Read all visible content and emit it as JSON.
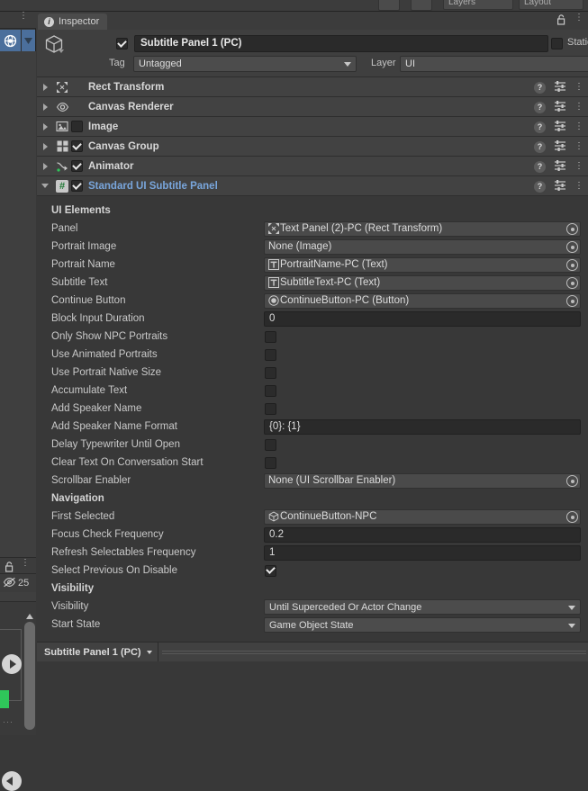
{
  "top_toolbar": {
    "layers_label": "Layers",
    "layout_label": "Layout"
  },
  "left_rail": {
    "tool_icon": "globe-handle-icon",
    "tool_caret_icon": "chevron-down-icon",
    "kebab_icon": "kebab-menu-icon",
    "lock_icon": "lock-open-icon",
    "hidden_count": "25",
    "hidden_icon": "eye-slash-icon",
    "play_icon": "play-circle-icon"
  },
  "tab": {
    "label": "Inspector",
    "info_icon": "info-icon",
    "badge_char": "i",
    "lock_icon": "lock-open-icon",
    "kebab_icon": "kebab-menu-icon"
  },
  "object_header": {
    "cube_icon": "gameobject-cube-icon",
    "enabled": true,
    "name": "Subtitle Panel 1 (PC)",
    "static_label": "Static",
    "static_checked": false,
    "tag_label": "Tag",
    "tag_value": "Untagged",
    "layer_label": "Layer",
    "layer_value": "UI"
  },
  "components": [
    {
      "name": "Rect Transform",
      "icon": "rect-transform-icon",
      "expanded": false,
      "has_checkbox": false,
      "checked": false,
      "is_script": false
    },
    {
      "name": "Canvas Renderer",
      "icon": "eye-icon",
      "expanded": false,
      "has_checkbox": false,
      "checked": false,
      "is_script": false
    },
    {
      "name": "Image",
      "icon": "image-icon",
      "expanded": false,
      "has_checkbox": true,
      "checked": false,
      "is_script": false
    },
    {
      "name": "Canvas Group",
      "icon": "canvas-group-icon",
      "expanded": false,
      "has_checkbox": true,
      "checked": true,
      "is_script": false
    },
    {
      "name": "Animator",
      "icon": "animator-icon",
      "expanded": false,
      "has_checkbox": true,
      "checked": true,
      "is_script": false
    },
    {
      "name": "Standard UI Subtitle Panel",
      "icon": "script-icon",
      "expanded": true,
      "has_checkbox": true,
      "checked": true,
      "is_script": true
    }
  ],
  "component_row_icons": {
    "help_char": "?",
    "help_icon": "help-icon",
    "preset_icon": "preset-sliders-icon",
    "kebab_icon": "kebab-menu-icon"
  },
  "properties": [
    {
      "kind": "section",
      "label": "UI Elements"
    },
    {
      "kind": "object",
      "label": "Panel",
      "value": "Text Panel (2)-PC (Rect Transform)",
      "icon": "rect-transform-icon",
      "has_icon": true
    },
    {
      "kind": "object",
      "label": "Portrait Image",
      "value": "None (Image)",
      "icon": "none-icon",
      "has_icon": false
    },
    {
      "kind": "object",
      "label": "Portrait Name",
      "value": "PortraitName-PC (Text)",
      "icon": "text-icon",
      "has_icon": true
    },
    {
      "kind": "object",
      "label": "Subtitle Text",
      "value": "SubtitleText-PC (Text)",
      "icon": "text-icon",
      "has_icon": true
    },
    {
      "kind": "object",
      "label": "Continue Button",
      "value": "ContinueButton-PC (Button)",
      "icon": "button-icon",
      "has_icon": true
    },
    {
      "kind": "number",
      "label": "Block Input Duration",
      "value": "0"
    },
    {
      "kind": "bool",
      "label": "Only Show NPC Portraits",
      "checked": false
    },
    {
      "kind": "bool",
      "label": "Use Animated Portraits",
      "checked": false
    },
    {
      "kind": "bool",
      "label": "Use Portrait Native Size",
      "checked": false
    },
    {
      "kind": "bool",
      "label": "Accumulate Text",
      "checked": false
    },
    {
      "kind": "bool",
      "label": "Add Speaker Name",
      "checked": false
    },
    {
      "kind": "number",
      "label": "Add Speaker Name Format",
      "value": "{0}: {1}"
    },
    {
      "kind": "bool",
      "label": "Delay Typewriter Until Open",
      "checked": false
    },
    {
      "kind": "bool",
      "label": "Clear Text On Conversation Start",
      "checked": false
    },
    {
      "kind": "object",
      "label": "Scrollbar Enabler",
      "value": "None (UI Scrollbar Enabler)",
      "icon": "none-icon",
      "has_icon": false
    },
    {
      "kind": "section",
      "label": "Navigation"
    },
    {
      "kind": "object",
      "label": "First Selected",
      "value": "ContinueButton-NPC",
      "icon": "gameobject-cube-icon",
      "has_icon": true
    },
    {
      "kind": "number",
      "label": "Focus Check Frequency",
      "value": "0.2"
    },
    {
      "kind": "number",
      "label": "Refresh Selectables Frequency",
      "value": "1"
    },
    {
      "kind": "bool",
      "label": "Select Previous On Disable",
      "checked": true
    },
    {
      "kind": "section",
      "label": "Visibility"
    },
    {
      "kind": "dropdown",
      "label": "Visibility",
      "value": "Until Superceded Or Actor Change"
    },
    {
      "kind": "dropdown",
      "label": "Start State",
      "value": "Game Object State"
    }
  ],
  "footer": {
    "breadcrumb": "Subtitle Panel 1 (PC)",
    "caret_icon": "chevron-down-icon"
  },
  "colors": {
    "background": "#383838",
    "panel": "#424242",
    "accent_blue": "#79a6dc",
    "tool_highlight": "#4b6f9c",
    "script_green": "#1f7a34",
    "green_chip": "#2fc65a"
  }
}
